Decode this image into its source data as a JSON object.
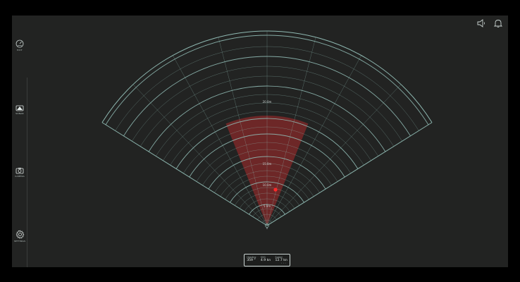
{
  "sidebar": {
    "items": [
      {
        "label": "Exit",
        "icon": "gauge-icon"
      },
      {
        "label": "Sonar",
        "icon": "sonar-camera-icon"
      },
      {
        "label": "Camera",
        "icon": "camera-icon"
      },
      {
        "label": "Settings",
        "icon": "gear-icon"
      }
    ]
  },
  "top_icons": [
    "speaker-icon",
    "bell-icon"
  ],
  "radar": {
    "range_labels": [
      "5.0m",
      "10.0m",
      "15.0m",
      "20.0m"
    ],
    "origin_label": "0",
    "target_color": "#ff2a2a",
    "grid_color": "#8fb9b2",
    "sector_color": "#8a2a2a"
  },
  "status": {
    "items": [
      {
        "label": "Heading",
        "value": "359 °"
      },
      {
        "label": "SOG",
        "value": "4.9 kn"
      },
      {
        "label": "Speed",
        "value": "12.7 kn"
      }
    ],
    "more": "• • •"
  }
}
